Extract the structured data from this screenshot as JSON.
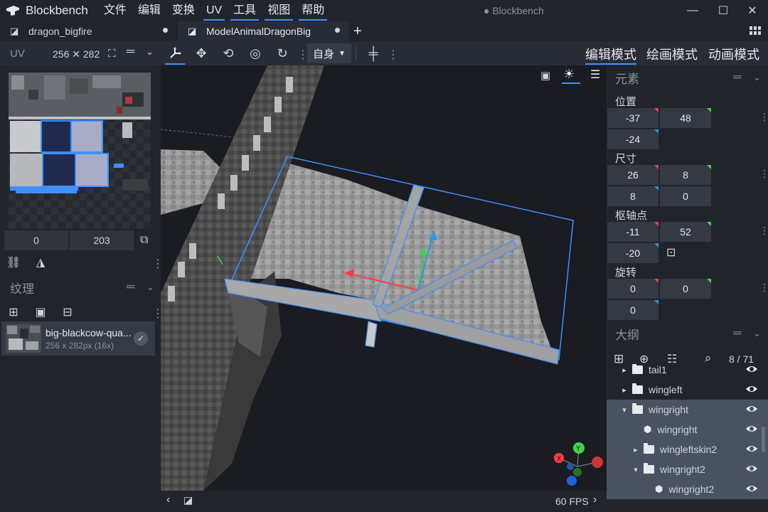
{
  "app": {
    "name": "Blockbench",
    "window_title": "● Blockbench"
  },
  "menu": [
    "文件",
    "编辑",
    "变换",
    "UV",
    "工具",
    "视图",
    "帮助"
  ],
  "tabs": [
    {
      "label": "dragon_bigfire",
      "active": false
    },
    {
      "label": "ModelAnimalDragonBig",
      "active": true
    }
  ],
  "uv": {
    "title": "UV",
    "size": "256 ✕ 282",
    "x": "0",
    "y": "203"
  },
  "toolbar": {
    "space": "自身"
  },
  "modes": [
    "编辑模式",
    "绘画模式",
    "动画模式"
  ],
  "texture": {
    "title": "纹理",
    "name": "big-blackcow-qua...",
    "info": "256 x 282px (16x)"
  },
  "element": {
    "title": "元素",
    "position_label": "位置",
    "position": [
      "-37",
      "48",
      "-24"
    ],
    "size_label": "尺寸",
    "size": [
      "26",
      "8",
      "8",
      "0"
    ],
    "pivot_label": "枢轴点",
    "pivot": [
      "-11",
      "52",
      "-20"
    ],
    "rotation_label": "旋转",
    "rotation": [
      "0",
      "0",
      "0"
    ]
  },
  "outliner": {
    "title": "大纲",
    "count": "8 / 71",
    "items": [
      {
        "label": "tail1",
        "type": "folder",
        "indent": 0,
        "expanded": false,
        "selected": false
      },
      {
        "label": "wingleft",
        "type": "folder",
        "indent": 0,
        "expanded": false,
        "selected": false
      },
      {
        "label": "wingright",
        "type": "folder",
        "indent": 0,
        "expanded": true,
        "selected": true
      },
      {
        "label": "wingright",
        "type": "cube",
        "indent": 1,
        "expanded": false,
        "selected": true
      },
      {
        "label": "wingleftskin2",
        "type": "folder",
        "indent": 1,
        "expanded": false,
        "selected": true
      },
      {
        "label": "wingright2",
        "type": "folder",
        "indent": 1,
        "expanded": true,
        "selected": true
      },
      {
        "label": "wingright2",
        "type": "cube",
        "indent": 2,
        "expanded": false,
        "selected": true
      }
    ]
  },
  "viewport": {
    "fps": "60 FPS"
  },
  "colors": {
    "accent": "#3e90ff",
    "axis_x": "#ff3b47",
    "axis_y": "#3fd44a",
    "axis_z": "#1b9dea"
  }
}
